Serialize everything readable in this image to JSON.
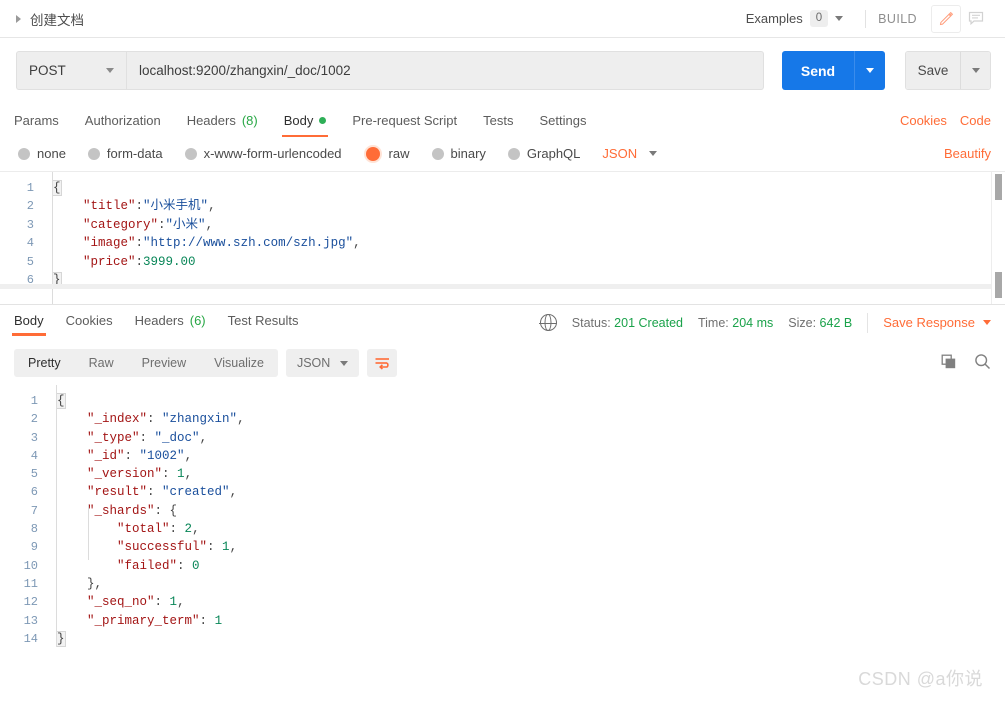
{
  "topbar": {
    "breadcrumb": "创建文档",
    "examples_label": "Examples",
    "examples_count": "0",
    "build_label": "BUILD",
    "edit_icon": "pencil-icon",
    "comment_icon": "comment-icon"
  },
  "request": {
    "method": "POST",
    "url": "localhost:9200/zhangxin/_doc/1002",
    "send_label": "Send",
    "save_label": "Save",
    "tabs": [
      {
        "label": "Params",
        "active": false
      },
      {
        "label": "Authorization",
        "active": false
      },
      {
        "label": "Headers",
        "count": "(8)",
        "active": false
      },
      {
        "label": "Body",
        "dot": true,
        "active": true
      },
      {
        "label": "Pre-request Script",
        "active": false
      },
      {
        "label": "Tests",
        "active": false
      },
      {
        "label": "Settings",
        "active": false
      }
    ],
    "cookies_link": "Cookies",
    "code_link": "Code",
    "body_types": [
      {
        "label": "none",
        "selected": false
      },
      {
        "label": "form-data",
        "selected": false
      },
      {
        "label": "x-www-form-urlencoded",
        "selected": false
      },
      {
        "label": "raw",
        "selected": true
      },
      {
        "label": "binary",
        "selected": false
      },
      {
        "label": "GraphQL",
        "selected": false
      }
    ],
    "raw_format": "JSON",
    "beautify_label": "Beautify",
    "body_lines": [
      {
        "n": "1",
        "tokens": [
          {
            "t": "{",
            "c": "p"
          }
        ]
      },
      {
        "n": "2",
        "tokens": [
          {
            "t": "    ",
            "c": "p"
          },
          {
            "t": "\"title\"",
            "c": "k"
          },
          {
            "t": ":",
            "c": "p"
          },
          {
            "t": "\"小米手机\"",
            "c": "s"
          },
          {
            "t": ",",
            "c": "p"
          }
        ]
      },
      {
        "n": "3",
        "tokens": [
          {
            "t": "    ",
            "c": "p"
          },
          {
            "t": "\"category\"",
            "c": "k"
          },
          {
            "t": ":",
            "c": "p"
          },
          {
            "t": "\"小米\"",
            "c": "s"
          },
          {
            "t": ",",
            "c": "p"
          }
        ]
      },
      {
        "n": "4",
        "tokens": [
          {
            "t": "    ",
            "c": "p"
          },
          {
            "t": "\"image\"",
            "c": "k"
          },
          {
            "t": ":",
            "c": "p"
          },
          {
            "t": "\"http://www.szh.com/szh.jpg\"",
            "c": "s"
          },
          {
            "t": ",",
            "c": "p"
          }
        ]
      },
      {
        "n": "5",
        "tokens": [
          {
            "t": "    ",
            "c": "p"
          },
          {
            "t": "\"price\"",
            "c": "k"
          },
          {
            "t": ":",
            "c": "p"
          },
          {
            "t": "3999.00",
            "c": "n"
          }
        ]
      },
      {
        "n": "6",
        "tokens": [
          {
            "t": "}",
            "c": "p"
          }
        ]
      }
    ]
  },
  "response": {
    "tabs": [
      {
        "label": "Body",
        "active": true
      },
      {
        "label": "Cookies",
        "active": false
      },
      {
        "label": "Headers",
        "count": "(6)",
        "active": false
      },
      {
        "label": "Test Results",
        "active": false
      }
    ],
    "status_label": "Status:",
    "status_value": "201 Created",
    "time_label": "Time:",
    "time_value": "204 ms",
    "size_label": "Size:",
    "size_value": "642 B",
    "save_response_label": "Save Response",
    "globe_icon": "globe-icon",
    "views": [
      {
        "label": "Pretty",
        "active": true
      },
      {
        "label": "Raw",
        "active": false
      },
      {
        "label": "Preview",
        "active": false
      },
      {
        "label": "Visualize",
        "active": false
      }
    ],
    "format": "JSON",
    "wrap_icon": "word-wrap-icon",
    "copy_icon": "copy-icon",
    "search_icon": "search-icon",
    "body_lines": [
      {
        "n": "1",
        "tokens": [
          {
            "t": "{",
            "c": "p"
          }
        ]
      },
      {
        "n": "2",
        "tokens": [
          {
            "t": "    ",
            "c": "p"
          },
          {
            "t": "\"_index\"",
            "c": "k"
          },
          {
            "t": ": ",
            "c": "p"
          },
          {
            "t": "\"zhangxin\"",
            "c": "s"
          },
          {
            "t": ",",
            "c": "p"
          }
        ]
      },
      {
        "n": "3",
        "tokens": [
          {
            "t": "    ",
            "c": "p"
          },
          {
            "t": "\"_type\"",
            "c": "k"
          },
          {
            "t": ": ",
            "c": "p"
          },
          {
            "t": "\"_doc\"",
            "c": "s"
          },
          {
            "t": ",",
            "c": "p"
          }
        ]
      },
      {
        "n": "4",
        "tokens": [
          {
            "t": "    ",
            "c": "p"
          },
          {
            "t": "\"_id\"",
            "c": "k"
          },
          {
            "t": ": ",
            "c": "p"
          },
          {
            "t": "\"1002\"",
            "c": "s"
          },
          {
            "t": ",",
            "c": "p"
          }
        ]
      },
      {
        "n": "5",
        "tokens": [
          {
            "t": "    ",
            "c": "p"
          },
          {
            "t": "\"_version\"",
            "c": "k"
          },
          {
            "t": ": ",
            "c": "p"
          },
          {
            "t": "1",
            "c": "n"
          },
          {
            "t": ",",
            "c": "p"
          }
        ]
      },
      {
        "n": "6",
        "tokens": [
          {
            "t": "    ",
            "c": "p"
          },
          {
            "t": "\"result\"",
            "c": "k"
          },
          {
            "t": ": ",
            "c": "p"
          },
          {
            "t": "\"created\"",
            "c": "s"
          },
          {
            "t": ",",
            "c": "p"
          }
        ]
      },
      {
        "n": "7",
        "tokens": [
          {
            "t": "    ",
            "c": "p"
          },
          {
            "t": "\"_shards\"",
            "c": "k"
          },
          {
            "t": ": {",
            "c": "p"
          }
        ]
      },
      {
        "n": "8",
        "tokens": [
          {
            "t": "        ",
            "c": "p"
          },
          {
            "t": "\"total\"",
            "c": "k"
          },
          {
            "t": ": ",
            "c": "p"
          },
          {
            "t": "2",
            "c": "n"
          },
          {
            "t": ",",
            "c": "p"
          }
        ]
      },
      {
        "n": "9",
        "tokens": [
          {
            "t": "        ",
            "c": "p"
          },
          {
            "t": "\"successful\"",
            "c": "k"
          },
          {
            "t": ": ",
            "c": "p"
          },
          {
            "t": "1",
            "c": "n"
          },
          {
            "t": ",",
            "c": "p"
          }
        ]
      },
      {
        "n": "10",
        "tokens": [
          {
            "t": "        ",
            "c": "p"
          },
          {
            "t": "\"failed\"",
            "c": "k"
          },
          {
            "t": ": ",
            "c": "p"
          },
          {
            "t": "0",
            "c": "n"
          }
        ]
      },
      {
        "n": "11",
        "tokens": [
          {
            "t": "    },",
            "c": "p"
          }
        ]
      },
      {
        "n": "12",
        "tokens": [
          {
            "t": "    ",
            "c": "p"
          },
          {
            "t": "\"_seq_no\"",
            "c": "k"
          },
          {
            "t": ": ",
            "c": "p"
          },
          {
            "t": "1",
            "c": "n"
          },
          {
            "t": ",",
            "c": "p"
          }
        ]
      },
      {
        "n": "13",
        "tokens": [
          {
            "t": "    ",
            "c": "p"
          },
          {
            "t": "\"_primary_term\"",
            "c": "k"
          },
          {
            "t": ": ",
            "c": "p"
          },
          {
            "t": "1",
            "c": "n"
          }
        ]
      },
      {
        "n": "14",
        "tokens": [
          {
            "t": "}",
            "c": "p"
          }
        ]
      }
    ]
  },
  "watermark": "CSDN @a你说",
  "colors": {
    "accent_orange": "#ff6c37",
    "send_blue": "#1678e8",
    "status_green": "#1aa24a"
  }
}
